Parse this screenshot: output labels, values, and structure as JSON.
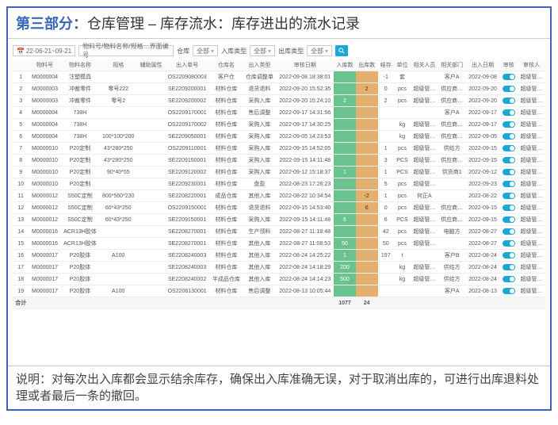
{
  "header": {
    "part": "第三部分：",
    "rest": "仓库管理 – 库存流水：库存进出的流水记录"
  },
  "toolbar": {
    "date_range": "22-06-21~09-21",
    "search_placeholder": "物料号/物料名称/规格…界面编号",
    "warehouse_lbl": "仓库",
    "warehouse_val": "全部",
    "intype_lbl": "入库类型",
    "intype_val": "全部",
    "outtype_lbl": "出库类型",
    "outtype_val": "全部"
  },
  "columns": [
    "",
    "物料号",
    "物料名称",
    "规格",
    "辅助属性",
    "出入单号",
    "仓库名",
    "出入类型",
    "审核日期",
    "入库数",
    "出库数",
    "结存",
    "单位",
    "相关人员",
    "相关部门",
    "出入日期",
    "审核",
    "审核人"
  ],
  "rows": [
    {
      "idx": "1",
      "code": "M0000004",
      "name": "注塑模具",
      "spec": "",
      "aux": "",
      "bill": "OS2209080003",
      "wh": "客户仓",
      "type": "仓库调整单",
      "date": "2022-09-08 18:38:01",
      "in": "",
      "out": "",
      "bal": "-1",
      "unit": "套",
      "person": "",
      "dept": "客户A",
      "odate": "2022-09-08",
      "op": "超级管…"
    },
    {
      "idx": "2",
      "code": "M0000003",
      "name": "冲裁零件",
      "spec": "零号222",
      "aux": "",
      "bill": "SE2209200001",
      "wh": "材料仓库",
      "type": "退货退料",
      "date": "2022-09-20 15:52:35",
      "in": "",
      "out": "2",
      "bal": "0",
      "unit": "pcs",
      "person": "超级管…",
      "dept": "供应商…",
      "odate": "2022-09-20",
      "op": "超级管…"
    },
    {
      "idx": "3",
      "code": "M0000003",
      "name": "冲裁零件",
      "spec": "零号2",
      "aux": "",
      "bill": "SE2209200002",
      "wh": "材料仓库",
      "type": "采购入库",
      "date": "2022-09-20 15:24:10",
      "in": "2",
      "out": "",
      "bal": "2",
      "unit": "pcs",
      "person": "超级管…",
      "dept": "供应商…",
      "odate": "2022-09-20",
      "op": "超级管…"
    },
    {
      "idx": "4",
      "code": "M0000004",
      "name": "738H",
      "spec": "",
      "aux": "",
      "bill": "OS2209170001",
      "wh": "材料仓库",
      "type": "售后调整",
      "date": "2022-09-17 14:31:56",
      "in": "",
      "out": "",
      "bal": "",
      "unit": "",
      "person": "",
      "dept": "客户A",
      "odate": "2022-09-17",
      "op": "超级管…"
    },
    {
      "idx": "5",
      "code": "M0000004",
      "name": "738H",
      "spec": "",
      "aux": "",
      "bill": "OS2209170002",
      "wh": "材料仓库",
      "type": "采购入库",
      "date": "2022-09-17 14:30:25",
      "in": "",
      "out": "",
      "bal": "",
      "unit": "kg",
      "person": "超级管…",
      "dept": "供应商…",
      "odate": "2022-09-17",
      "op": "超级管…"
    },
    {
      "idx": "6",
      "code": "M0000004",
      "name": "738H",
      "spec": "100*100*200",
      "aux": "",
      "bill": "SE2209050001",
      "wh": "材料仓库",
      "type": "采购入库",
      "date": "2022-09-05 14:23:53",
      "in": "",
      "out": "",
      "bal": "",
      "unit": "kg",
      "person": "超级管…",
      "dept": "供应商…",
      "odate": "2022-09-05",
      "op": "超级管…"
    },
    {
      "idx": "7",
      "code": "M0000010",
      "name": "P20定制",
      "spec": "43*280*250",
      "aux": "",
      "bill": "OS2209110001",
      "wh": "材料仓库",
      "type": "采购入库",
      "date": "2022-09-15 14:52:05",
      "in": "",
      "out": "",
      "bal": "1",
      "unit": "pcs",
      "person": "超级管…",
      "dept": "供给方",
      "odate": "2022-09-15",
      "op": "超级管…"
    },
    {
      "idx": "8",
      "code": "M0000010",
      "name": "P20定制",
      "spec": "43*280*250",
      "aux": "",
      "bill": "SE2209150001",
      "wh": "材料仓库",
      "type": "采购入库",
      "date": "2022-09-15 14:11:48",
      "in": "",
      "out": "",
      "bal": "3",
      "unit": "PCS",
      "person": "超级管…",
      "dept": "供应商…",
      "odate": "2022-09-15",
      "op": "超级管…"
    },
    {
      "idx": "9",
      "code": "M0000010",
      "name": "P20定制",
      "spec": "90*40*55",
      "aux": "",
      "bill": "SE2209120002",
      "wh": "材料仓库",
      "type": "采购入库",
      "date": "2022-09-12 15:18:37",
      "in": "1",
      "out": "",
      "bal": "1",
      "unit": "PCS",
      "person": "超级管…",
      "dept": "供货商1",
      "odate": "2022-09-12",
      "op": "超级管…"
    },
    {
      "idx": "10",
      "code": "M0000010",
      "name": "P20定制",
      "spec": "",
      "aux": "",
      "bill": "SE2209230001",
      "wh": "材料仓库",
      "type": "盘盈",
      "date": "2022-08-23 17:26:23",
      "in": "",
      "out": "",
      "bal": "5",
      "unit": "pcs",
      "person": "超级管…",
      "dept": "",
      "odate": "2022-09-23",
      "op": "超级管…"
    },
    {
      "idx": "11",
      "code": "M0000012",
      "name": "S50C定制",
      "spec": "800*560*230",
      "aux": "",
      "bill": "SE2208220001",
      "wh": "成品仓库",
      "type": "其他入库",
      "date": "2022-08-22 10:34:54",
      "in": "",
      "out": "-2",
      "bal": "1",
      "unit": "pcs",
      "person": "何正A",
      "dept": "",
      "odate": "2022-08-22",
      "op": "超级管…"
    },
    {
      "idx": "12",
      "code": "M0000012",
      "name": "S50C定制",
      "spec": "60*43*250",
      "aux": "",
      "bill": "OS2209150001",
      "wh": "材料仓库",
      "type": "退货退料",
      "date": "2022-09-15 14:53:40",
      "in": "",
      "out": "6",
      "bal": "0",
      "unit": "pcs",
      "person": "超级管…",
      "dept": "供应商…",
      "odate": "2022-09-15",
      "op": "超级管…"
    },
    {
      "idx": "13",
      "code": "M0000012",
      "name": "S50C定制",
      "spec": "60*43*250",
      "aux": "",
      "bill": "SE2209150001",
      "wh": "材料仓库",
      "type": "采购入库",
      "date": "2022-09-15 14:11:48",
      "in": "6",
      "out": "",
      "bal": "6",
      "unit": "PCS",
      "person": "超级管…",
      "dept": "供应商…",
      "odate": "2022-09-15",
      "op": "超级管…"
    },
    {
      "idx": "14",
      "code": "M0000016",
      "name": "ACR13H胶体",
      "spec": "",
      "aux": "",
      "bill": "SE2208270001",
      "wh": "材料仓库",
      "type": "生产领料",
      "date": "2022-08-27 11:18:48",
      "in": "",
      "out": "",
      "bal": "42",
      "unit": "pcs",
      "person": "超级管…",
      "dept": "电脑方",
      "odate": "2022-08-27",
      "op": "超级管…"
    },
    {
      "idx": "15",
      "code": "M0000016",
      "name": "ACR13H胶体",
      "spec": "",
      "aux": "",
      "bill": "SE2208270001",
      "wh": "材料仓库",
      "type": "其他入库",
      "date": "2022-08-27 11:08:53",
      "in": "50",
      "out": "",
      "bal": "50",
      "unit": "pcs",
      "person": "超级管…",
      "dept": "",
      "odate": "2022-08-27",
      "op": "超级管…"
    },
    {
      "idx": "16",
      "code": "M0000017",
      "name": "P20胶体",
      "spec": "A100",
      "aux": "",
      "bill": "SE2208240003",
      "wh": "材料仓库",
      "type": "其他入库",
      "date": "2022-08-24 14:25:22",
      "in": "1",
      "out": "",
      "bal": "197",
      "unit": "t",
      "person": "",
      "dept": "客户B",
      "odate": "2022-08-24",
      "op": "超级管…"
    },
    {
      "idx": "17",
      "code": "M0000017",
      "name": "P20胶体",
      "spec": "",
      "aux": "",
      "bill": "SE2208240003",
      "wh": "材料仓库",
      "type": "其他入库",
      "date": "2022-08-24 14:18:29",
      "in": "200",
      "out": "",
      "bal": "",
      "unit": "kg",
      "person": "超级管…",
      "dept": "供给方",
      "odate": "2022-08-24",
      "op": "超级管…"
    },
    {
      "idx": "18",
      "code": "M0000017",
      "name": "P20胶体",
      "spec": "",
      "aux": "",
      "bill": "SE2208240002",
      "wh": "半成品仓库",
      "type": "其他入库",
      "date": "2022-08-24 14:14:23",
      "in": "500",
      "out": "",
      "bal": "",
      "unit": "kg",
      "person": "超级管…",
      "dept": "供给方",
      "odate": "2022-08-24",
      "op": "超级管…"
    },
    {
      "idx": "19",
      "code": "M0000017",
      "name": "P20胶体",
      "spec": "A100",
      "aux": "",
      "bill": "OS2208130001",
      "wh": "材料仓库",
      "type": "售后调整",
      "date": "2022-08-13 10:05:44",
      "in": "",
      "out": "",
      "bal": "",
      "unit": "",
      "person": "",
      "dept": "客户A",
      "odate": "2022-08-13",
      "op": "超级管…"
    }
  ],
  "totals": {
    "label": "合计",
    "in": "1077",
    "out": "24"
  },
  "footer": {
    "prefix": "说明：",
    "text": "对每次出入库都会显示结余库存，确保出入库准确无误，对于取消出库的，可进行出库退料处理或者最后一条的撤回。"
  }
}
